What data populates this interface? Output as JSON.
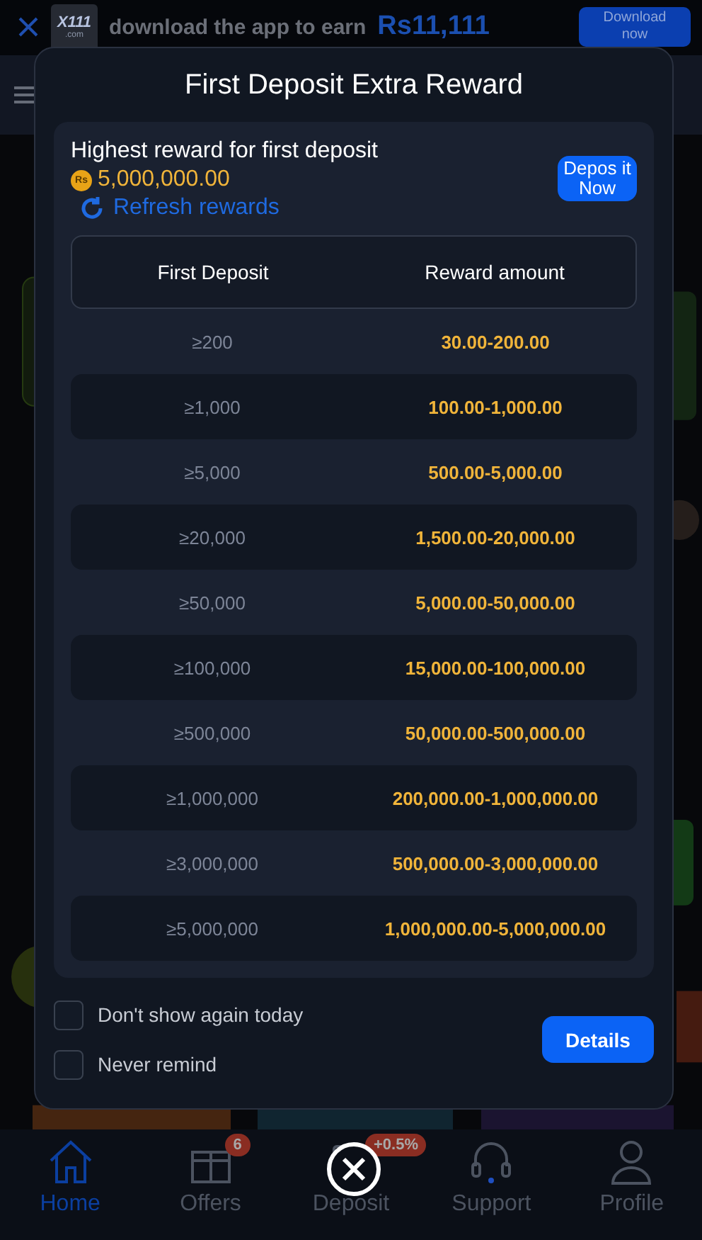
{
  "banner": {
    "logo": {
      "mark": "X111",
      "domain": ".com"
    },
    "text": "download the app to earn",
    "amount": "Rs11,111",
    "button": "Download now"
  },
  "modal": {
    "title": "First Deposit Extra Reward",
    "highest": {
      "label": "Highest reward for first deposit",
      "currency": "Rs",
      "amount": "5,000,000.00"
    },
    "refresh": "Refresh rewards",
    "deposit_button": "Depos it Now",
    "table": {
      "columns": [
        "First Deposit",
        "Reward amount"
      ],
      "rows": [
        {
          "deposit": "≥200",
          "reward": "30.00-200.00"
        },
        {
          "deposit": "≥1,000",
          "reward": "100.00-1,000.00"
        },
        {
          "deposit": "≥5,000",
          "reward": "500.00-5,000.00"
        },
        {
          "deposit": "≥20,000",
          "reward": "1,500.00-20,000.00"
        },
        {
          "deposit": "≥50,000",
          "reward": "5,000.00-50,000.00"
        },
        {
          "deposit": "≥100,000",
          "reward": "15,000.00-100,000.00"
        },
        {
          "deposit": "≥500,000",
          "reward": "50,000.00-500,000.00"
        },
        {
          "deposit": "≥1,000,000",
          "reward": "200,000.00-1,000,000.00"
        },
        {
          "deposit": "≥3,000,000",
          "reward": "500,000.00-3,000,000.00"
        },
        {
          "deposit": "≥5,000,000",
          "reward": "1,000,000.00-5,000,000.00"
        }
      ]
    },
    "options": [
      {
        "label": "Don't show again today",
        "checked": false
      },
      {
        "label": "Never remind",
        "checked": false
      }
    ],
    "details_button": "Details"
  },
  "bottom_nav": [
    {
      "kind": "home",
      "label": "Home",
      "selected": true
    },
    {
      "kind": "offers",
      "label": "Offers",
      "selected": false,
      "badge": "6"
    },
    {
      "kind": "deposit",
      "label": "Deposit",
      "selected": false,
      "badge": "+0.5%"
    },
    {
      "kind": "support",
      "label": "Support",
      "selected": false
    },
    {
      "kind": "profile",
      "label": "Profile",
      "selected": false
    }
  ]
}
